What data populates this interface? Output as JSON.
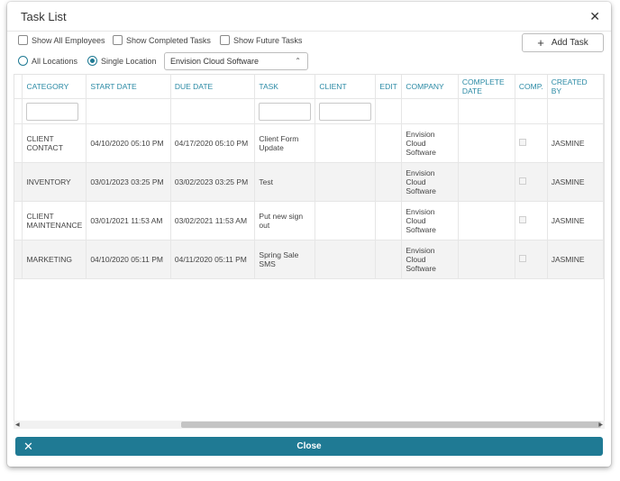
{
  "dialog": {
    "title": "Task List",
    "close_icon": "close-icon"
  },
  "options": {
    "show_all_employees": "Show All Employees",
    "show_completed_tasks": "Show Completed Tasks",
    "show_future_tasks": "Show Future Tasks",
    "all_locations": "All Locations",
    "single_location": "Single Location",
    "location_value": "Envision Cloud Software"
  },
  "add_task": {
    "label": "Add Task",
    "icon": "plus-icon"
  },
  "table": {
    "headers": [
      "CATEGORY",
      "START DATE",
      "DUE DATE",
      "TASK",
      "CLIENT",
      "EDIT",
      "COMPANY",
      "COMPLETE DATE",
      "COMP.",
      "CREATED BY"
    ],
    "rows": [
      [
        "CLIENT CONTACT",
        "04/10/2020 05:10 PM",
        "04/17/2020 05:10 PM",
        "Client Form Update",
        "",
        "",
        "Envision Cloud Software",
        "",
        "",
        "JASMINE"
      ],
      [
        "INVENTORY",
        "03/01/2023 03:25 PM",
        "03/02/2023 03:25 PM",
        "Test",
        "",
        "",
        "Envision Cloud Software",
        "",
        "",
        "JASMINE"
      ],
      [
        "CLIENT MAINTENANCE",
        "03/01/2021 11:53 AM",
        "03/02/2021 11:53 AM",
        "Put new sign out",
        "",
        "",
        "Envision Cloud Software",
        "",
        "",
        "JASMINE"
      ],
      [
        "MARKETING",
        "04/10/2020 05:11 PM",
        "04/11/2020 05:11 PM",
        "Spring Sale SMS",
        "",
        "",
        "Envision Cloud Software",
        "",
        "",
        "JASMINE"
      ]
    ]
  },
  "footer": {
    "close_label": "Close"
  }
}
